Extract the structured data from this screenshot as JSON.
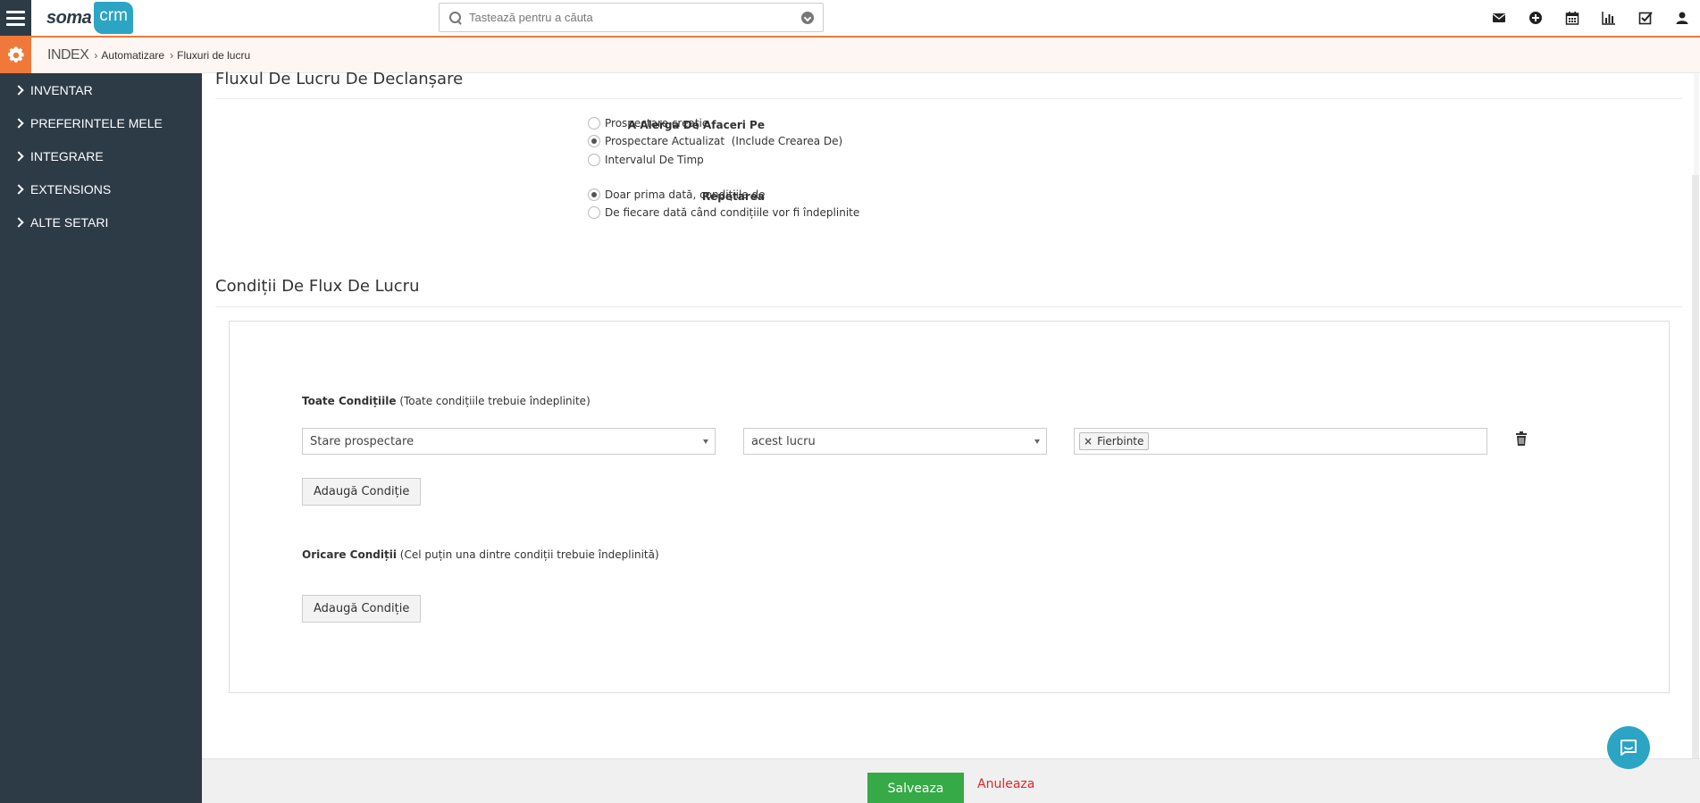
{
  "brand": {
    "logo_left": "soma",
    "logo_right": "crm"
  },
  "search": {
    "placeholder": "Tastează pentru a căuta"
  },
  "top_icons": [
    "envelope-icon",
    "plus-circle-icon",
    "calendar-icon",
    "bar-chart-icon",
    "checkbox-icon",
    "user-icon"
  ],
  "breadcrumb": {
    "index": "INDEX",
    "items": [
      "Automatizare",
      "Fluxuri de lucru"
    ]
  },
  "sidebar": {
    "items": [
      {
        "label": "INVENTAR"
      },
      {
        "label": "PREFERINTELE MELE"
      },
      {
        "label": "INTEGRARE"
      },
      {
        "label": "EXTENSIONS"
      },
      {
        "label": "ALTE SETARI"
      }
    ]
  },
  "trigger_section": {
    "title": "Fluxul De Lucru De Declanșare",
    "run_on": {
      "label": "A Alerga De Afaceri Pe",
      "options": [
        {
          "label": "Prospectare creație",
          "checked": false
        },
        {
          "label": "Prospectare Actualizat  (Include Crearea De)",
          "checked": true
        },
        {
          "label": "Intervalul De Timp",
          "checked": false
        }
      ]
    },
    "repeat": {
      "label": "Repetarea",
      "options": [
        {
          "label": "Doar prima dată, condițiile de",
          "checked": true
        },
        {
          "label": "De fiecare dată când condițiile vor fi îndeplinite",
          "checked": false
        }
      ]
    }
  },
  "conditions_section": {
    "title": "Condiții De Flux De Lucru",
    "all": {
      "title": "Toate Condițiile",
      "note": "(Toate condițiile trebuie îndeplinite)",
      "rows": [
        {
          "field": "Stare prospectare",
          "operator": "acest lucru",
          "values": [
            "Fierbinte"
          ]
        }
      ],
      "add_label": "Adaugă Condiție"
    },
    "any": {
      "title": "Oricare Condiții",
      "note": "(Cel puțin una dintre condiții trebuie îndeplinită)",
      "add_label": "Adaugă Condiție"
    }
  },
  "footer": {
    "save_label": "Salveaza",
    "cancel_label": "Anuleaza"
  },
  "colors": {
    "accent_orange": "#f0793a",
    "sidebar_bg": "#2d3b47",
    "brand_teal": "#2ba5c3",
    "save_green": "#35aa47",
    "cancel_red": "#e8242a"
  }
}
